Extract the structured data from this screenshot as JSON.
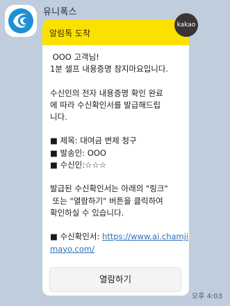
{
  "sender": {
    "name": "유니폭스"
  },
  "badge": {
    "label": "kakao"
  },
  "message": {
    "header_title": "알림톡 도착",
    "lines": [
      " OOO 고객님!",
      "1분 셀프 내용증명 참지마요입니다.",
      "",
      "수신인의 전자 내용증명 확인 완료",
      "에 따라 수신확인서를 발급해드립",
      "니다.",
      "",
      "■ 제목: 대여금 변제 청구",
      "■ 발송인: OOO",
      "■ 수신인:☆☆☆",
      "",
      "발급된 수신확인서는 아래의 \"링크\"",
      " 또는 \"열람하기\" 버튼을 클릭하여",
      "확인하실 수 있습니다.",
      ""
    ],
    "cert_label": "■ 수신확인서: ",
    "cert_link_line1": "https://www.ai.chamji",
    "cert_link_line2": "mayo.com/",
    "open_button_label": "열람하기"
  },
  "timestamp": "오후 4:03",
  "colors": {
    "chat_background": "#bfcddc",
    "header_yellow": "#fae100",
    "link_blue": "#2c6fb7"
  },
  "icons": {
    "avatar": "unipox-logo-icon"
  }
}
